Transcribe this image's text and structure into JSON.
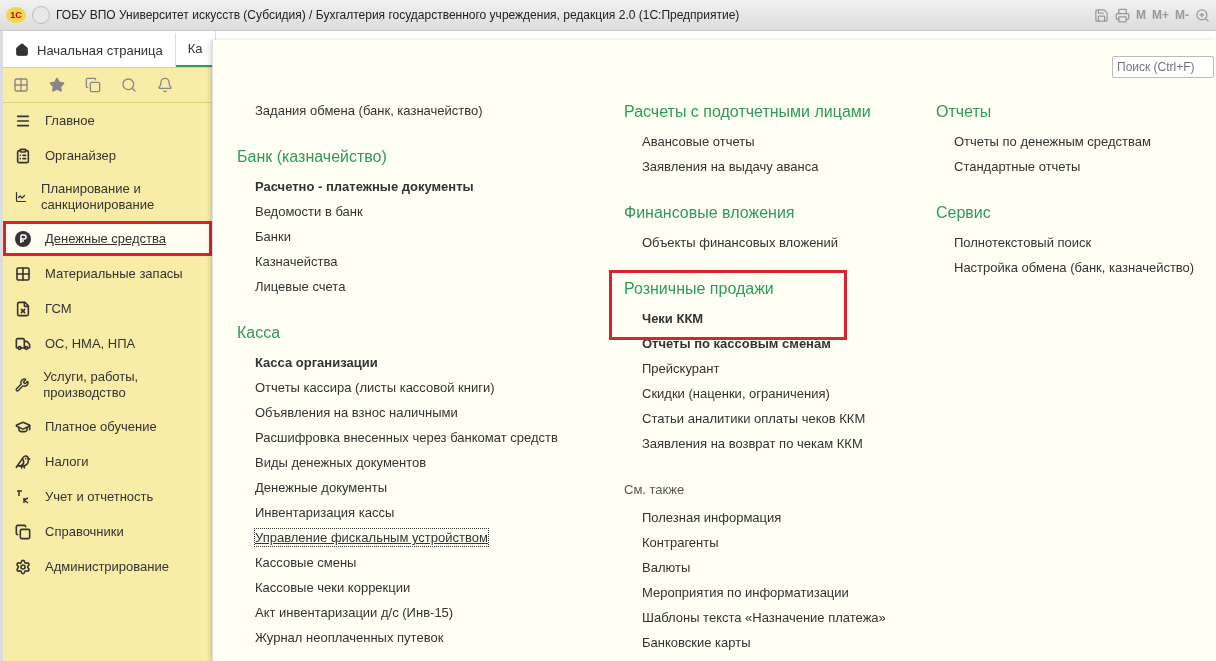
{
  "window": {
    "title": "ГОБУ ВПО Университет искусств (Субсидия) / Бухгалтерия государственного учреждения, редакция 2.0  (1С:Предприятие)",
    "logo": "1С",
    "memory_buttons": [
      "M",
      "M+",
      "M-"
    ]
  },
  "tabs": [
    {
      "label": "Начальная страница",
      "kind": "home",
      "selected": false
    },
    {
      "label": "Ка",
      "kind": "plain",
      "selected": true
    }
  ],
  "sidebar": {
    "items": [
      {
        "label": "Главное",
        "selected": false
      },
      {
        "label": "Органайзер",
        "selected": false
      },
      {
        "label": "Планирование и санкционирование",
        "selected": false
      },
      {
        "label": "Денежные средства",
        "selected": true
      },
      {
        "label": "Материальные запасы",
        "selected": false
      },
      {
        "label": "ГСМ",
        "selected": false
      },
      {
        "label": "ОС, НМА, НПА",
        "selected": false
      },
      {
        "label": "Услуги, работы, производство",
        "selected": false
      },
      {
        "label": "Платное обучение",
        "selected": false
      },
      {
        "label": "Налоги",
        "selected": false
      },
      {
        "label": "Учет и отчетность",
        "selected": false
      },
      {
        "label": "Справочники",
        "selected": false
      },
      {
        "label": "Администрирование",
        "selected": false
      }
    ]
  },
  "search": {
    "placeholder": "Поиск (Ctrl+F)"
  },
  "columns": [
    {
      "groups": [
        {
          "items": [
            {
              "label": "Задания обмена (банк, казначейство)",
              "bold": false,
              "focused": false
            }
          ]
        },
        {
          "kind": "section",
          "title": "Банк (казначейство)",
          "items": [
            {
              "label": "Расчетно - платежные документы",
              "bold": true,
              "focused": false
            },
            {
              "label": "Ведомости в банк",
              "bold": false,
              "focused": false
            },
            {
              "label": "Банки",
              "bold": false,
              "focused": false
            },
            {
              "label": "Казначейства",
              "bold": false,
              "focused": false
            },
            {
              "label": "Лицевые счета",
              "bold": false,
              "focused": false
            }
          ]
        },
        {
          "kind": "section",
          "title": "Касса",
          "items": [
            {
              "label": "Касса организации",
              "bold": true,
              "focused": false
            },
            {
              "label": "Отчеты кассира (листы кассовой книги)",
              "bold": false,
              "focused": false
            },
            {
              "label": "Объявления на взнос наличными",
              "bold": false,
              "focused": false
            },
            {
              "label": "Расшифровка внесенных через банкомат средств",
              "bold": false,
              "focused": false
            },
            {
              "label": "Виды денежных документов",
              "bold": false,
              "focused": false
            },
            {
              "label": "Денежные документы",
              "bold": false,
              "focused": false
            },
            {
              "label": "Инвентаризация кассы",
              "bold": false,
              "focused": false
            },
            {
              "label": "Управление фискальным устройством",
              "bold": false,
              "focused": true
            },
            {
              "label": "Кассовые смены",
              "bold": false,
              "focused": false
            },
            {
              "label": "Кассовые чеки коррекции",
              "bold": false,
              "focused": false
            },
            {
              "label": "Акт инвентаризации д/с (Инв-15)",
              "bold": false,
              "focused": false
            },
            {
              "label": "Журнал неоплаченных путевок",
              "bold": false,
              "focused": false
            }
          ]
        }
      ]
    },
    {
      "groups": [
        {
          "kind": "section",
          "title": "Расчеты с подотчетными лицами",
          "items": [
            {
              "label": "Авансовые отчеты",
              "bold": false,
              "focused": false
            },
            {
              "label": "Заявления на выдачу аванса",
              "bold": false,
              "focused": false
            }
          ]
        },
        {
          "kind": "section",
          "title": "Финансовые вложения",
          "items": [
            {
              "label": "Объекты финансовых вложений",
              "bold": false,
              "focused": false
            }
          ]
        },
        {
          "kind": "section",
          "title": "Розничные продажи",
          "outlined": true,
          "items": [
            {
              "label": "Чеки ККМ",
              "bold": true,
              "focused": false
            },
            {
              "label": "Отчеты по кассовым сменам",
              "bold": true,
              "focused": false
            },
            {
              "label": "Прейскурант",
              "bold": false,
              "focused": false
            },
            {
              "label": "Скидки (наценки, ограничения)",
              "bold": false,
              "focused": false
            },
            {
              "label": "Статьи аналитики оплаты чеков ККМ",
              "bold": false,
              "focused": false
            },
            {
              "label": "Заявления на возврат по чекам ККМ",
              "bold": false,
              "focused": false
            }
          ]
        },
        {
          "kind": "see_also",
          "title": "См. также",
          "items": [
            {
              "label": "Полезная информация",
              "bold": false,
              "focused": false
            },
            {
              "label": "Контрагенты",
              "bold": false,
              "focused": false
            },
            {
              "label": "Валюты",
              "bold": false,
              "focused": false
            },
            {
              "label": "Мероприятия по информатизации",
              "bold": false,
              "focused": false
            },
            {
              "label": "Шаблоны текста «Назначение платежа»",
              "bold": false,
              "focused": false
            },
            {
              "label": "Банковские карты",
              "bold": false,
              "focused": false
            }
          ]
        }
      ]
    },
    {
      "groups": [
        {
          "kind": "section",
          "title": "Отчеты",
          "items": [
            {
              "label": "Отчеты по денежным средствам",
              "bold": false,
              "focused": false
            },
            {
              "label": "Стандартные отчеты",
              "bold": false,
              "focused": false
            }
          ]
        },
        {
          "kind": "section",
          "title": "Сервис",
          "items": [
            {
              "label": "Полнотекстовый поиск",
              "bold": false,
              "focused": false
            },
            {
              "label": "Настройка обмена (банк, казначейство)",
              "bold": false,
              "focused": false
            }
          ]
        }
      ]
    }
  ]
}
